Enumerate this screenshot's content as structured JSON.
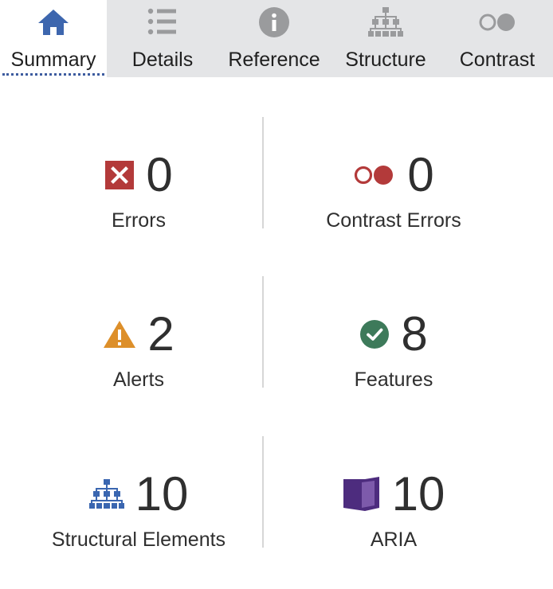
{
  "tabs": [
    {
      "label": "Summary",
      "icon": "home-icon",
      "active": true
    },
    {
      "label": "Details",
      "icon": "list-icon",
      "active": false
    },
    {
      "label": "Reference",
      "icon": "info-icon",
      "active": false
    },
    {
      "label": "Structure",
      "icon": "hierarchy-icon",
      "active": false
    },
    {
      "label": "Contrast",
      "icon": "contrast-icon",
      "active": false
    }
  ],
  "summary": {
    "errors": {
      "count": "0",
      "label": "Errors",
      "icon": "error-icon",
      "color": "#b33a3a"
    },
    "contrast_errors": {
      "count": "0",
      "label": "Contrast Errors",
      "icon": "contrast-error-icon",
      "color": "#b33a3a"
    },
    "alerts": {
      "count": "2",
      "label": "Alerts",
      "icon": "alert-icon",
      "color": "#dd8f2a"
    },
    "features": {
      "count": "8",
      "label": "Features",
      "icon": "feature-check-icon",
      "color": "#3d7a5a"
    },
    "structural": {
      "count": "10",
      "label": "Structural Elements",
      "icon": "structure-icon",
      "color": "#3a66b0"
    },
    "aria": {
      "count": "10",
      "label": "ARIA",
      "icon": "aria-icon",
      "color": "#4d2c7e"
    }
  },
  "colors": {
    "tab_bar_bg": "#e4e5e7",
    "active_tab_bg": "#ffffff",
    "active_underline": "#3d5c9f",
    "inactive_icon": "#9a9b9d",
    "home_icon": "#3d66ae"
  }
}
